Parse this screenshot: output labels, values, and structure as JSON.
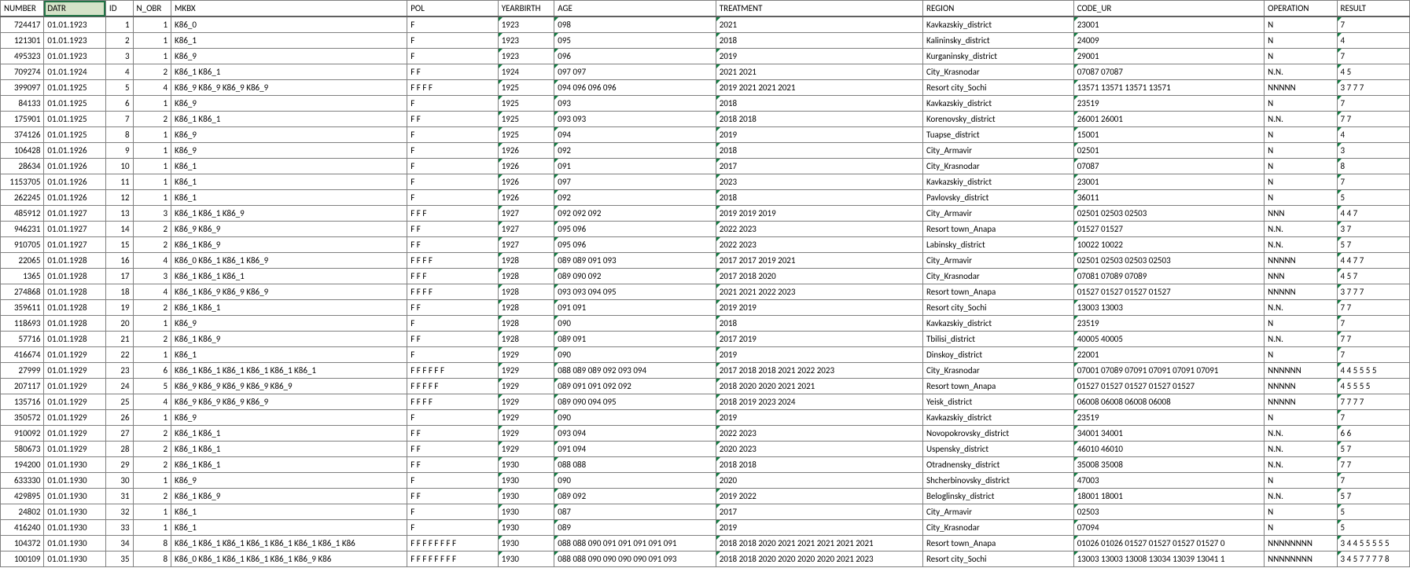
{
  "headers": {
    "number": "NUMBER",
    "datr": "DATR",
    "id": "ID",
    "n_obr": "N_OBR",
    "mkbx": "MKBX",
    "pol": "POL",
    "yearbirth": "YEARBIRTH",
    "age": "AGE",
    "treatment": "TREATMENT",
    "region": "REGION",
    "code_ur": "CODE_UR",
    "operation": "OPERATION",
    "result": "RESULT"
  },
  "rows": [
    {
      "number": "724417",
      "datr": "01.01.1923",
      "id": "1",
      "n_obr": "1",
      "mkbx": "K86_0",
      "pol": "F",
      "yearbirth": "1923",
      "age": "098",
      "treatment": "2021",
      "region": "Kavkazskiy_district",
      "code_ur": "23001",
      "operation": "N",
      "result": "7"
    },
    {
      "number": "121301",
      "datr": "01.01.1923",
      "id": "2",
      "n_obr": "1",
      "mkbx": "K86_1",
      "pol": "F",
      "yearbirth": "1923",
      "age": "095",
      "treatment": "2018",
      "region": "Kalininsky_district",
      "code_ur": "24009",
      "operation": "N",
      "result": "4"
    },
    {
      "number": "495323",
      "datr": "01.01.1923",
      "id": "3",
      "n_obr": "1",
      "mkbx": "K86_9",
      "pol": "F",
      "yearbirth": "1923",
      "age": "096",
      "treatment": "2019",
      "region": "Kurganinsky_district",
      "code_ur": "29001",
      "operation": "N",
      "result": "7"
    },
    {
      "number": "709274",
      "datr": "01.01.1924",
      "id": "4",
      "n_obr": "2",
      "mkbx": "K86_1 K86_1",
      "pol": "F F",
      "yearbirth": "1924",
      "age": "097 097",
      "treatment": "2021 2021",
      "region": "City_Krasnodar",
      "code_ur": "07087 07087",
      "operation": "N.N.",
      "result": "4 5"
    },
    {
      "number": "399097",
      "datr": "01.01.1925",
      "id": "5",
      "n_obr": "4",
      "mkbx": "K86_9 K86_9 K86_9 K86_9",
      "pol": "F F F F",
      "yearbirth": "1925",
      "age": "094 096 096 096",
      "treatment": "2019 2021 2021 2021",
      "region": "Resort city_Sochi",
      "code_ur": "13571 13571 13571 13571",
      "operation": "NNNNN",
      "result": "3 7 7 7"
    },
    {
      "number": "84133",
      "datr": "01.01.1925",
      "id": "6",
      "n_obr": "1",
      "mkbx": "K86_9",
      "pol": "F",
      "yearbirth": "1925",
      "age": "093",
      "treatment": "2018",
      "region": "Kavkazskiy_district",
      "code_ur": "23519",
      "operation": "N",
      "result": "7"
    },
    {
      "number": "175901",
      "datr": "01.01.1925",
      "id": "7",
      "n_obr": "2",
      "mkbx": "K86_1 K86_1",
      "pol": "F F",
      "yearbirth": "1925",
      "age": "093 093",
      "treatment": "2018 2018",
      "region": "Korenovsky_district",
      "code_ur": "26001 26001",
      "operation": "N.N.",
      "result": "7 7"
    },
    {
      "number": "374126",
      "datr": "01.01.1925",
      "id": "8",
      "n_obr": "1",
      "mkbx": "K86_9",
      "pol": "F",
      "yearbirth": "1925",
      "age": "094",
      "treatment": "2019",
      "region": "Tuapse_district",
      "code_ur": "15001",
      "operation": "N",
      "result": "4"
    },
    {
      "number": "106428",
      "datr": "01.01.1926",
      "id": "9",
      "n_obr": "1",
      "mkbx": "K86_9",
      "pol": "F",
      "yearbirth": "1926",
      "age": "092",
      "treatment": "2018",
      "region": "City_Armavir",
      "code_ur": "02501",
      "operation": "N",
      "result": "3"
    },
    {
      "number": "28634",
      "datr": "01.01.1926",
      "id": "10",
      "n_obr": "1",
      "mkbx": "K86_1",
      "pol": "F",
      "yearbirth": "1926",
      "age": "091",
      "treatment": "2017",
      "region": "City_Krasnodar",
      "code_ur": "07087",
      "operation": "N",
      "result": "8"
    },
    {
      "number": "1153705",
      "datr": "01.01.1926",
      "id": "11",
      "n_obr": "1",
      "mkbx": "K86_1",
      "pol": "F",
      "yearbirth": "1926",
      "age": "097",
      "treatment": "2023",
      "region": "Kavkazskiy_district",
      "code_ur": "23001",
      "operation": "N",
      "result": "7"
    },
    {
      "number": "262245",
      "datr": "01.01.1926",
      "id": "12",
      "n_obr": "1",
      "mkbx": "K86_1",
      "pol": "F",
      "yearbirth": "1926",
      "age": "092",
      "treatment": "2018",
      "region": "Pavlovsky_district",
      "code_ur": "36011",
      "operation": "N",
      "result": "5"
    },
    {
      "number": "485912",
      "datr": "01.01.1927",
      "id": "13",
      "n_obr": "3",
      "mkbx": "K86_1 K86_1 K86_9",
      "pol": "F F F",
      "yearbirth": "1927",
      "age": "092 092 092",
      "treatment": "2019 2019 2019",
      "region": "City_Armavir",
      "code_ur": "02501 02503 02503",
      "operation": "NNN",
      "result": "4 4 7"
    },
    {
      "number": "946231",
      "datr": "01.01.1927",
      "id": "14",
      "n_obr": "2",
      "mkbx": "K86_9 K86_9",
      "pol": "F F",
      "yearbirth": "1927",
      "age": "095 096",
      "treatment": "2022 2023",
      "region": "Resort town_Anapa",
      "code_ur": "01527 01527",
      "operation": "N.N.",
      "result": "3 7"
    },
    {
      "number": "910705",
      "datr": "01.01.1927",
      "id": "15",
      "n_obr": "2",
      "mkbx": "K86_1 K86_9",
      "pol": "F F",
      "yearbirth": "1927",
      "age": "095 096",
      "treatment": "2022 2023",
      "region": "Labinsky_district",
      "code_ur": "10022 10022",
      "operation": "N.N.",
      "result": "5 7"
    },
    {
      "number": "22065",
      "datr": "01.01.1928",
      "id": "16",
      "n_obr": "4",
      "mkbx": "K86_0 K86_1 K86_1 K86_9",
      "pol": "F F F F",
      "yearbirth": "1928",
      "age": "089 089 091 093",
      "treatment": "2017 2017 2019 2021",
      "region": "City_Armavir",
      "code_ur": "02501 02503 02503 02503",
      "operation": "NNNNN",
      "result": "4 4 7 7"
    },
    {
      "number": "1365",
      "datr": "01.01.1928",
      "id": "17",
      "n_obr": "3",
      "mkbx": "K86_1 K86_1 K86_1",
      "pol": "F F F",
      "yearbirth": "1928",
      "age": "089 090 092",
      "treatment": "2017 2018 2020",
      "region": "City_Krasnodar",
      "code_ur": "07081 07089 07089",
      "operation": "NNN",
      "result": "4 5 7"
    },
    {
      "number": "274868",
      "datr": "01.01.1928",
      "id": "18",
      "n_obr": "4",
      "mkbx": "K86_1 K86_9 K86_9 K86_9",
      "pol": "F F F F",
      "yearbirth": "1928",
      "age": "093 093 094 095",
      "treatment": "2021 2021 2022 2023",
      "region": "Resort town_Anapa",
      "code_ur": "01527 01527 01527 01527",
      "operation": "NNNNN",
      "result": "3 7 7 7"
    },
    {
      "number": "359611",
      "datr": "01.01.1928",
      "id": "19",
      "n_obr": "2",
      "mkbx": "K86_1 K86_1",
      "pol": "F F",
      "yearbirth": "1928",
      "age": "091 091",
      "treatment": "2019 2019",
      "region": "Resort city_Sochi",
      "code_ur": "13003 13003",
      "operation": "N.N.",
      "result": "7 7"
    },
    {
      "number": "118693",
      "datr": "01.01.1928",
      "id": "20",
      "n_obr": "1",
      "mkbx": "K86_9",
      "pol": "F",
      "yearbirth": "1928",
      "age": "090",
      "treatment": "2018",
      "region": "Kavkazskiy_district",
      "code_ur": "23519",
      "operation": "N",
      "result": "7"
    },
    {
      "number": "57716",
      "datr": "01.01.1928",
      "id": "21",
      "n_obr": "2",
      "mkbx": "K86_1 K86_9",
      "pol": "F F",
      "yearbirth": "1928",
      "age": "089 091",
      "treatment": "2017 2019",
      "region": "Tbilisi_district",
      "code_ur": "40005 40005",
      "operation": "N.N.",
      "result": "7 7"
    },
    {
      "number": "416674",
      "datr": "01.01.1929",
      "id": "22",
      "n_obr": "1",
      "mkbx": "K86_1",
      "pol": "F",
      "yearbirth": "1929",
      "age": "090",
      "treatment": "2019",
      "region": "Dinskoy_district",
      "code_ur": "22001",
      "operation": "N",
      "result": "7"
    },
    {
      "number": "27999",
      "datr": "01.01.1929",
      "id": "23",
      "n_obr": "6",
      "mkbx": "K86_1 K86_1 K86_1 K86_1 K86_1 K86_1",
      "pol": "F F F F F F",
      "yearbirth": "1929",
      "age": "088 089 089 092 093 094",
      "treatment": "2017 2018 2018 2021 2022 2023",
      "region": "City_Krasnodar",
      "code_ur": "07001 07089 07091 07091 07091 07091",
      "operation": "NNNNNN",
      "result": "4 4 5 5 5 5"
    },
    {
      "number": "207117",
      "datr": "01.01.1929",
      "id": "24",
      "n_obr": "5",
      "mkbx": "K86_9 K86_9 K86_9 K86_9 K86_9",
      "pol": "F F F F F",
      "yearbirth": "1929",
      "age": "089 091 091 092 092",
      "treatment": "2018 2020 2020 2021 2021",
      "region": "Resort town_Anapa",
      "code_ur": "01527 01527 01527 01527 01527",
      "operation": "NNNNN",
      "result": "4 5 5 5 5"
    },
    {
      "number": "135716",
      "datr": "01.01.1929",
      "id": "25",
      "n_obr": "4",
      "mkbx": "K86_9 K86_9 K86_9 K86_9",
      "pol": "F F F F",
      "yearbirth": "1929",
      "age": "089 090 094 095",
      "treatment": "2018 2019 2023 2024",
      "region": "Yeisk_district",
      "code_ur": "06008 06008 06008 06008",
      "operation": "NNNNN",
      "result": "7 7 7 7"
    },
    {
      "number": "350572",
      "datr": "01.01.1929",
      "id": "26",
      "n_obr": "1",
      "mkbx": "K86_9",
      "pol": "F",
      "yearbirth": "1929",
      "age": "090",
      "treatment": "2019",
      "region": "Kavkazskiy_district",
      "code_ur": "23519",
      "operation": "N",
      "result": "7"
    },
    {
      "number": "910092",
      "datr": "01.01.1929",
      "id": "27",
      "n_obr": "2",
      "mkbx": "K86_1 K86_1",
      "pol": "F F",
      "yearbirth": "1929",
      "age": "093 094",
      "treatment": "2022 2023",
      "region": "Novopokrovsky_district",
      "code_ur": "34001 34001",
      "operation": "N.N.",
      "result": "6 6"
    },
    {
      "number": "580673",
      "datr": "01.01.1929",
      "id": "28",
      "n_obr": "2",
      "mkbx": "K86_1 K86_1",
      "pol": "F F",
      "yearbirth": "1929",
      "age": "091 094",
      "treatment": "2020 2023",
      "region": "Uspensky_district",
      "code_ur": "46010 46010",
      "operation": "N.N.",
      "result": "5 7"
    },
    {
      "number": "194200",
      "datr": "01.01.1930",
      "id": "29",
      "n_obr": "2",
      "mkbx": "K86_1 K86_1",
      "pol": "F F",
      "yearbirth": "1930",
      "age": "088 088",
      "treatment": "2018 2018",
      "region": "Otradnensky_district",
      "code_ur": "35008 35008",
      "operation": "N.N.",
      "result": "7 7"
    },
    {
      "number": "633330",
      "datr": "01.01.1930",
      "id": "30",
      "n_obr": "1",
      "mkbx": "K86_9",
      "pol": "F",
      "yearbirth": "1930",
      "age": "090",
      "treatment": "2020",
      "region": "Shcherbinovsky_district",
      "code_ur": "47003",
      "operation": "N",
      "result": "7"
    },
    {
      "number": "429895",
      "datr": "01.01.1930",
      "id": "31",
      "n_obr": "2",
      "mkbx": "K86_1 K86_9",
      "pol": "F F",
      "yearbirth": "1930",
      "age": "089 092",
      "treatment": "2019 2022",
      "region": "Beloglinsky_district",
      "code_ur": "18001 18001",
      "operation": "N.N.",
      "result": "5 7"
    },
    {
      "number": "24802",
      "datr": "01.01.1930",
      "id": "32",
      "n_obr": "1",
      "mkbx": "K86_1",
      "pol": "F",
      "yearbirth": "1930",
      "age": "087",
      "treatment": "2017",
      "region": "City_Armavir",
      "code_ur": "02503",
      "operation": "N",
      "result": "5"
    },
    {
      "number": "416240",
      "datr": "01.01.1930",
      "id": "33",
      "n_obr": "1",
      "mkbx": "K86_1",
      "pol": "F",
      "yearbirth": "1930",
      "age": "089",
      "treatment": "2019",
      "region": "City_Krasnodar",
      "code_ur": "07094",
      "operation": "N",
      "result": "5"
    },
    {
      "number": "104372",
      "datr": "01.01.1930",
      "id": "34",
      "n_obr": "8",
      "mkbx": "K86_1 K86_1 K86_1 K86_1 K86_1 K86_1 K86_1 K86",
      "pol": "F F F F F F F F",
      "yearbirth": "1930",
      "age": "088 088 090 091 091 091 091 091",
      "treatment": "2018 2018 2020 2021 2021 2021 2021 2021",
      "region": "Resort town_Anapa",
      "code_ur": "01026 01026 01527 01527 01527 01527 0",
      "operation": "NNNNNNNN",
      "result": "3 4 4 5 5 5 5 5"
    },
    {
      "number": "100109",
      "datr": "01.01.1930",
      "id": "35",
      "n_obr": "8",
      "mkbx": "K86_0 K86_1 K86_1 K86_1 K86_1 K86_9 K86",
      "pol": "F F F F F F F F",
      "yearbirth": "1930",
      "age": "088 088 090 090 090 090 091 093",
      "treatment": "2018 2018 2020 2020 2020 2020 2021 2023",
      "region": "Resort city_Sochi",
      "code_ur": "13003 13003 13008 13034 13039 13041 1",
      "operation": "NNNNNNNN",
      "result": "3 4 5 7 7 7 7 8"
    }
  ]
}
